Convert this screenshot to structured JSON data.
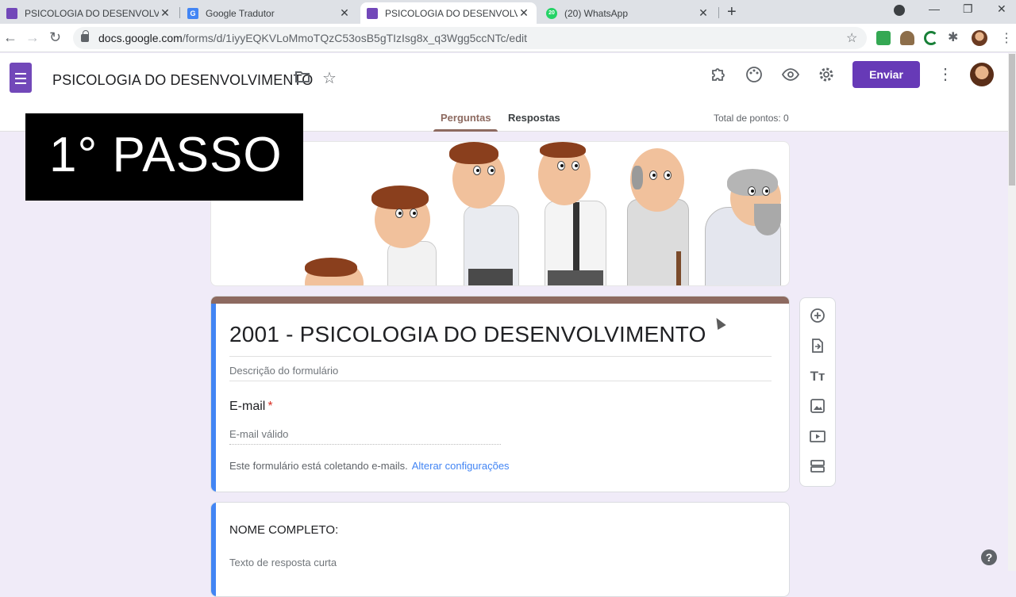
{
  "browser": {
    "tabs": [
      {
        "title": "PSICOLOGIA DO DESENVOLVIME",
        "icon": "google-forms-icon",
        "active": false
      },
      {
        "title": "Google Tradutor",
        "icon": "google-translate-icon",
        "active": false
      },
      {
        "title": "PSICOLOGIA DO DESENVOLVIME",
        "icon": "google-forms-icon",
        "active": true
      },
      {
        "title": "(20) WhatsApp",
        "icon": "whatsapp-icon",
        "active": false,
        "badge": "20"
      }
    ],
    "new_tab": "+",
    "url_host": "docs.google.com",
    "url_path": "/forms/d/1iyyEQKVLoMmoTQzC53osB5gTIzIsg8x_q3Wgg5ccNTc/edit"
  },
  "forms_header": {
    "doc_title": "PSICOLOGIA DO DESENVOLVIMENTO",
    "send_label": "Enviar",
    "tabs": [
      {
        "label": "Perguntas",
        "active": true
      },
      {
        "label": "Respostas",
        "active": false
      }
    ],
    "total_points": "Total de pontos: 0",
    "accent_color": "#673ab7",
    "theme_color": "#8d6a60"
  },
  "overlay": {
    "step_label": "1° PASSO"
  },
  "form": {
    "title": "2001 - PSICOLOGIA DO DESENVOLVIMENTO",
    "description_placeholder": "Descrição do formulário",
    "email": {
      "label": "E-mail",
      "required_mark": "*",
      "placeholder": "E-mail válido",
      "collecting_note": "Este formulário está coletando e-mails.",
      "settings_link": "Alterar configurações"
    },
    "questions": [
      {
        "label": "NOME COMPLETO:",
        "placeholder": "Texto de resposta curta"
      }
    ]
  },
  "help": "?"
}
